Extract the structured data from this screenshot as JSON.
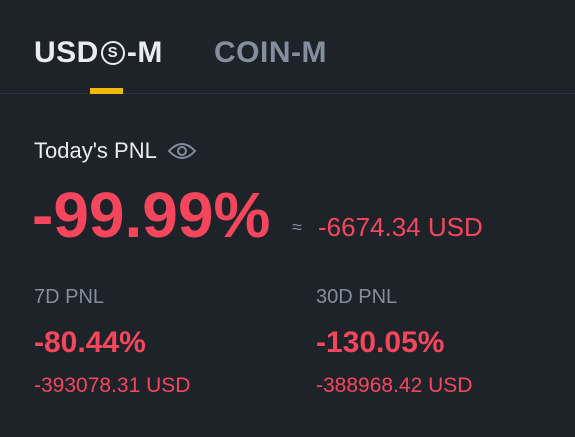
{
  "tabs": {
    "usds_prefix": "USD",
    "usds_symbol": "S",
    "usds_suffix": "-M",
    "coin": "COIN-M",
    "active": "USDⓈ-M"
  },
  "today": {
    "label": "Today's PNL",
    "percent": "-99.99%",
    "approx": "≈",
    "usd": "-6674.34 USD"
  },
  "pnl_7d": {
    "label": "7D PNL",
    "percent": "-80.44%",
    "usd": "-393078.31 USD"
  },
  "pnl_30d": {
    "label": "30D PNL",
    "percent": "-130.05%",
    "usd": "-388968.42 USD"
  },
  "colors": {
    "background": "#1e2329",
    "negative": "#f6465d",
    "accent": "#f0b90b",
    "muted": "#848e9c"
  },
  "icons": {
    "visibility": "eye-icon"
  }
}
